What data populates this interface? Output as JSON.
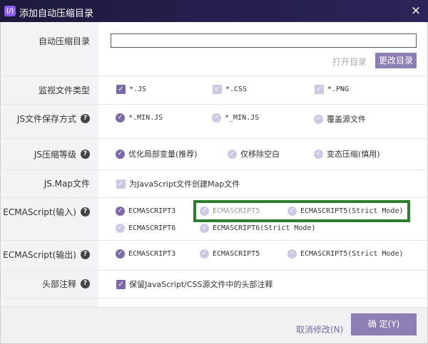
{
  "window": {
    "title": "添加自动压缩目录",
    "close": "×",
    "app_icon": "⟨/⟩"
  },
  "path": {
    "label": "自动压缩目录",
    "value": "",
    "open_button": "打开目录",
    "change_button": "更改目录"
  },
  "watch": {
    "label": "监视文件类型",
    "options": [
      "*.JS",
      "*.CSS",
      "*.PNG"
    ]
  },
  "save": {
    "label": "JS文件保存方式",
    "options": [
      "*.MIN.JS",
      "*_MIN.JS",
      "覆盖源文件"
    ]
  },
  "level": {
    "label": "JS压缩等级",
    "options": [
      "优化局部变量(推荐)",
      "仅移除空白",
      "变态压缩(慎用)"
    ]
  },
  "map": {
    "label": "JS.Map文件",
    "option": "为JavaScript文件创建Map文件"
  },
  "ecma_in": {
    "label": "ECMAScript(输入)",
    "options": [
      "ECMASCRIPT3",
      "ECMASCRIPT5",
      "ECMASCRIPT5(Strict Mode)",
      "ECMASCRIPT6",
      "ECMASCRIPT6(Strict Mode)"
    ]
  },
  "ecma_out": {
    "label": "ECMAScript(输出)",
    "options": [
      "ECMASCRIPT3",
      "ECMASCRIPT5",
      "ECMASCRIPT5(Strict Mode)"
    ]
  },
  "header": {
    "label": "头部注释",
    "option": "保留JavaScript/CSS源文件中的头部注释"
  },
  "footer": {
    "cancel": "取消修改(N)",
    "ok": "确 定(Y)"
  },
  "help_glyph": "?",
  "check_glyph": "✓",
  "colors": {
    "accent": "#8c7fb3",
    "titlebar": "#241f4d",
    "highlight": "#2e7d32"
  }
}
